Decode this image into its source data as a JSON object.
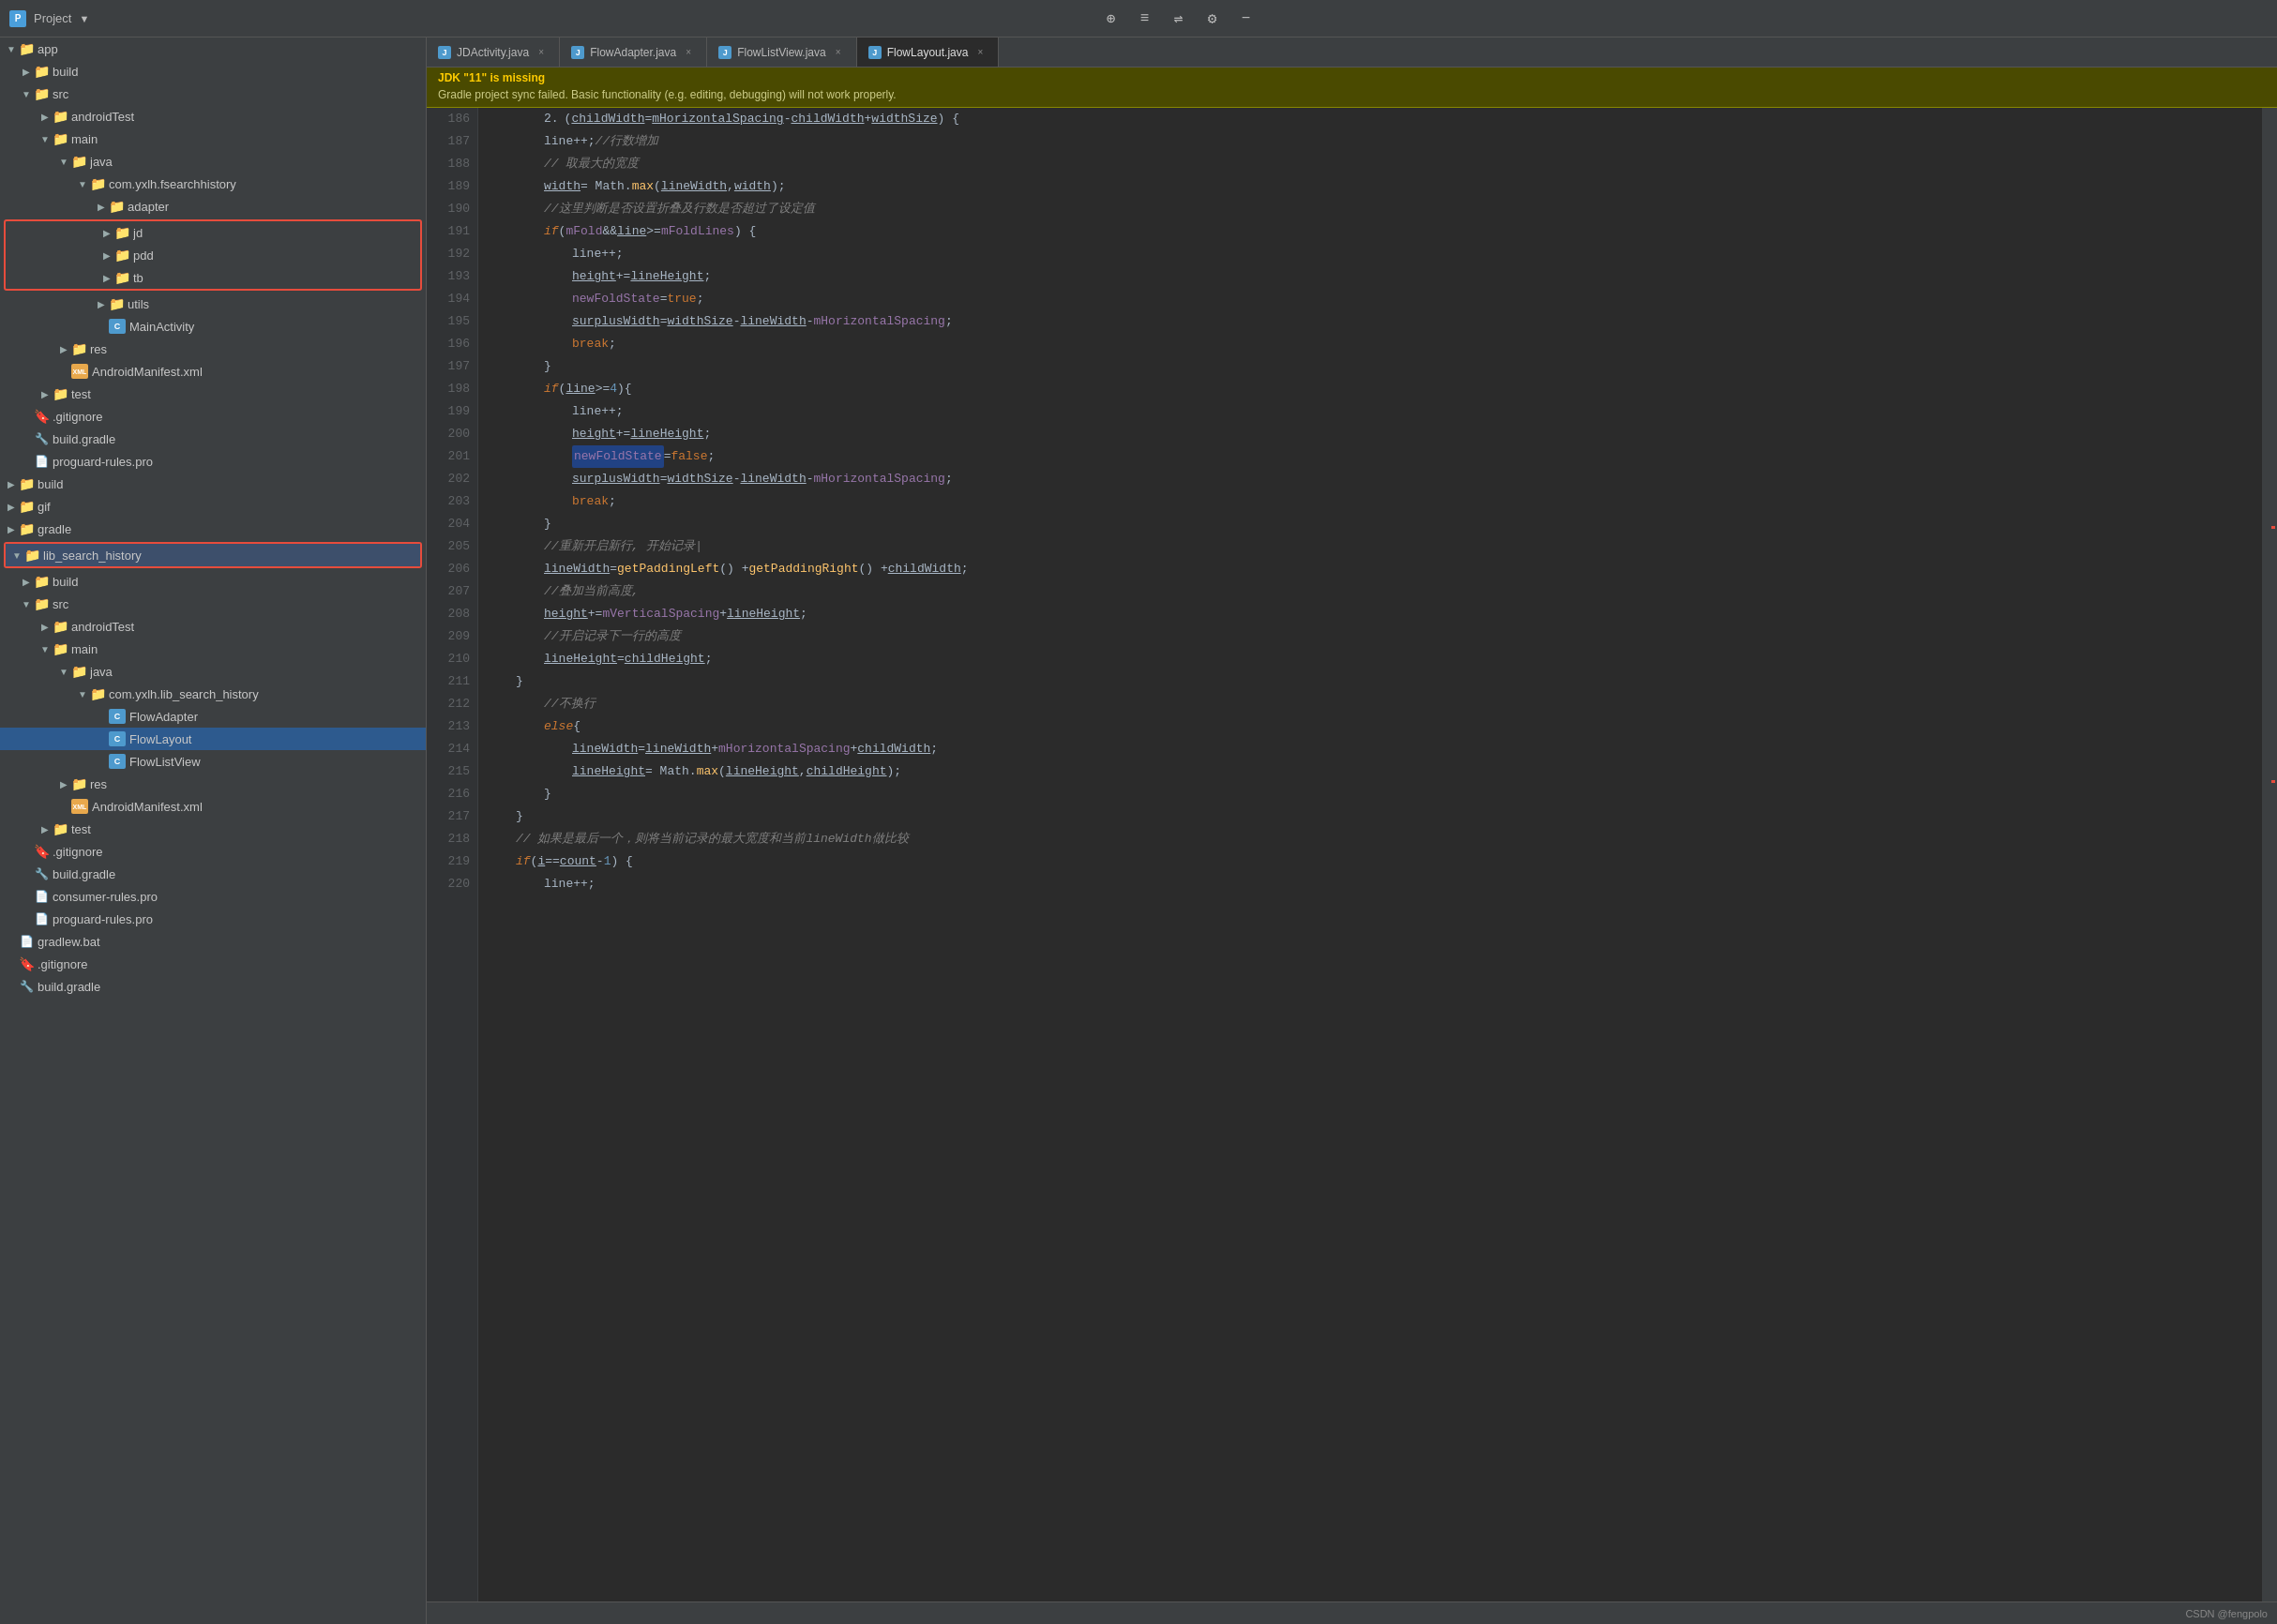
{
  "titlebar": {
    "project_label": "Project",
    "dropdown_arrow": "▼",
    "icons": [
      "⊕",
      "≡",
      "⇌",
      "⚙",
      "−"
    ]
  },
  "tabs": [
    {
      "label": "JDActivity.java",
      "icon_color": "#4e9acd",
      "icon_text": "J",
      "active": false
    },
    {
      "label": "FlowAdapter.java",
      "icon_color": "#4e9acd",
      "icon_text": "J",
      "active": false
    },
    {
      "label": "FlowListView.java",
      "icon_color": "#4e9acd",
      "icon_text": "J",
      "active": false
    },
    {
      "label": "FlowLayout.java",
      "icon_color": "#4e9acd",
      "icon_text": "J",
      "active": true
    }
  ],
  "warning": {
    "title": "JDK \"11\" is missing",
    "description": "Gradle project sync failed. Basic functionality (e.g. editing, debugging) will not work properly."
  },
  "sidebar": {
    "items": [
      {
        "indent": 0,
        "arrow": "▼",
        "icon": "folder",
        "label": "app",
        "type": "folder",
        "selected": false
      },
      {
        "indent": 1,
        "arrow": "▶",
        "icon": "folder",
        "label": "build",
        "type": "folder"
      },
      {
        "indent": 1,
        "arrow": "▼",
        "icon": "folder",
        "label": "src",
        "type": "folder"
      },
      {
        "indent": 2,
        "arrow": "▶",
        "icon": "folder",
        "label": "androidTest",
        "type": "folder"
      },
      {
        "indent": 2,
        "arrow": "▼",
        "icon": "folder",
        "label": "main",
        "type": "folder"
      },
      {
        "indent": 3,
        "arrow": "▼",
        "icon": "folder",
        "label": "java",
        "type": "folder"
      },
      {
        "indent": 4,
        "arrow": "▼",
        "icon": "folder",
        "label": "com.yxlh.fsearchhistory",
        "type": "folder"
      },
      {
        "indent": 5,
        "arrow": "▶",
        "icon": "folder",
        "label": "adapter",
        "type": "folder"
      },
      {
        "indent": 5,
        "arrow": "▶",
        "icon": "folder",
        "label": "jd",
        "type": "folder",
        "red_border": true
      },
      {
        "indent": 5,
        "arrow": "▶",
        "icon": "folder",
        "label": "pdd",
        "type": "folder",
        "red_border": true
      },
      {
        "indent": 5,
        "arrow": "▶",
        "icon": "folder",
        "label": "tb",
        "type": "folder",
        "red_border": true
      },
      {
        "indent": 5,
        "arrow": "▶",
        "icon": "folder",
        "label": "utils",
        "type": "folder"
      },
      {
        "indent": 5,
        "arrow": "",
        "icon": "java",
        "label": "MainActivity",
        "type": "java"
      },
      {
        "indent": 3,
        "arrow": "▶",
        "icon": "folder",
        "label": "res",
        "type": "folder"
      },
      {
        "indent": 3,
        "arrow": "",
        "icon": "xml",
        "label": "AndroidManifest.xml",
        "type": "xml"
      },
      {
        "indent": 2,
        "arrow": "▶",
        "icon": "folder",
        "label": "test",
        "type": "folder"
      },
      {
        "indent": 1,
        "arrow": "",
        "icon": "git",
        "label": ".gitignore",
        "type": "git"
      },
      {
        "indent": 1,
        "arrow": "",
        "icon": "gradle",
        "label": "build.gradle",
        "type": "gradle"
      },
      {
        "indent": 1,
        "arrow": "",
        "icon": "pro",
        "label": "proguard-rules.pro",
        "type": "pro"
      },
      {
        "indent": 0,
        "arrow": "▶",
        "icon": "folder",
        "label": "build",
        "type": "folder"
      },
      {
        "indent": 0,
        "arrow": "▶",
        "icon": "folder",
        "label": "gif",
        "type": "folder"
      },
      {
        "indent": 0,
        "arrow": "▶",
        "icon": "folder",
        "label": "gradle",
        "type": "folder"
      },
      {
        "indent": 0,
        "arrow": "▼",
        "icon": "folder",
        "label": "lib_search_history",
        "type": "folder",
        "red_border_full": true
      },
      {
        "indent": 1,
        "arrow": "▶",
        "icon": "folder",
        "label": "build",
        "type": "folder"
      },
      {
        "indent": 1,
        "arrow": "▼",
        "icon": "folder",
        "label": "src",
        "type": "folder"
      },
      {
        "indent": 2,
        "arrow": "▶",
        "icon": "folder",
        "label": "androidTest",
        "type": "folder"
      },
      {
        "indent": 2,
        "arrow": "▼",
        "icon": "folder",
        "label": "main",
        "type": "folder"
      },
      {
        "indent": 3,
        "arrow": "▼",
        "icon": "folder",
        "label": "java",
        "type": "folder"
      },
      {
        "indent": 4,
        "arrow": "▼",
        "icon": "folder",
        "label": "com.yxlh.lib_search_history",
        "type": "folder"
      },
      {
        "indent": 5,
        "arrow": "",
        "icon": "java",
        "label": "FlowAdapter",
        "type": "java"
      },
      {
        "indent": 5,
        "arrow": "",
        "icon": "java",
        "label": "FlowLayout",
        "type": "java",
        "selected": true
      },
      {
        "indent": 5,
        "arrow": "",
        "icon": "java",
        "label": "FlowListView",
        "type": "java"
      },
      {
        "indent": 3,
        "arrow": "▶",
        "icon": "folder",
        "label": "res",
        "type": "folder"
      },
      {
        "indent": 3,
        "arrow": "",
        "icon": "xml",
        "label": "AndroidManifest.xml",
        "type": "xml"
      },
      {
        "indent": 2,
        "arrow": "▶",
        "icon": "folder",
        "label": "test",
        "type": "folder"
      },
      {
        "indent": 1,
        "arrow": "",
        "icon": "git",
        "label": ".gitignore",
        "type": "git"
      },
      {
        "indent": 1,
        "arrow": "",
        "icon": "gradle",
        "label": "build.gradle",
        "type": "gradle"
      },
      {
        "indent": 1,
        "arrow": "",
        "icon": "pro",
        "label": "consumer-rules.pro",
        "type": "pro"
      },
      {
        "indent": 1,
        "arrow": "",
        "icon": "pro",
        "label": "proguard-rules.pro",
        "type": "pro"
      },
      {
        "indent": 0,
        "arrow": "",
        "icon": "bat",
        "label": "gradlew.bat",
        "type": "bat"
      },
      {
        "indent": 0,
        "arrow": "",
        "icon": "git",
        "label": ".gitignore",
        "type": "git"
      },
      {
        "indent": 0,
        "arrow": "",
        "icon": "gradle",
        "label": "build.gradle",
        "type": "gradle"
      }
    ]
  },
  "code": {
    "lines": [
      {
        "num": 186,
        "content": "line++;<span class='cmt'>// 行数增加</span>",
        "raw": true
      },
      {
        "num": 187,
        "text": "// 取最大的宽度",
        "type": "comment_cn"
      },
      {
        "num": 188,
        "raw_text": "width = Math.max(lineWidth, width);"
      },
      {
        "num": 189,
        "text": "//这里判断是否设置折叠及行数是否超过了设定值",
        "type": "comment_cn"
      },
      {
        "num": 190,
        "raw_text": "if (mFold && line >= mFoldLines) {",
        "fold": true
      },
      {
        "num": 191,
        "raw_text": "    line++;"
      },
      {
        "num": 192,
        "raw_text": "    height += lineHeight;"
      },
      {
        "num": 193,
        "raw_text": "    newFoldState = true;"
      },
      {
        "num": 194,
        "raw_text": "    surplusWidth = widthSize - lineWidth - mHorizontalSpacing;"
      },
      {
        "num": 195,
        "raw_text": "    break;"
      },
      {
        "num": 196,
        "raw_text": "}"
      },
      {
        "num": 197,
        "raw_text": "if(line >= 4){",
        "fold": true
      },
      {
        "num": 198,
        "raw_text": "    line++;"
      },
      {
        "num": 199,
        "raw_text": "    height += lineHeight;",
        "height_underline": true
      },
      {
        "num": 200,
        "raw_text": "    newFoldState = false;",
        "highlight": "newFoldState"
      },
      {
        "num": 201,
        "raw_text": "    surplusWidth = widthSize - lineWidth - mHorizontalSpacing;"
      },
      {
        "num": 202,
        "raw_text": "    break;"
      },
      {
        "num": 203,
        "raw_text": "}"
      },
      {
        "num": 204,
        "text": "//重新开启新行, 开始记录|",
        "type": "comment_cn"
      },
      {
        "num": 205,
        "raw_text": "lineWidth = getPaddingLeft() + getPaddingRight() + childWidth;"
      },
      {
        "num": 206,
        "text": "//叠加当前高度,",
        "type": "comment_cn"
      },
      {
        "num": 207,
        "raw_text": "height += mVerticalSpacing + lineHeight;",
        "height_underline": true
      },
      {
        "num": 208,
        "text": "//开启记录下一行的高度",
        "type": "comment_cn"
      },
      {
        "num": 209,
        "raw_text": "lineHeight = childHeight;"
      },
      {
        "num": 210,
        "raw_text": "}"
      },
      {
        "num": 211,
        "text": "//不换行",
        "type": "comment_cn"
      },
      {
        "num": 212,
        "raw_text": "else {"
      },
      {
        "num": 213,
        "raw_text": "    lineWidth = lineWidth + mHorizontalSpacing + childWidth;"
      },
      {
        "num": 214,
        "raw_text": "    lineHeight = Math.max(lineHeight, childHeight);"
      },
      {
        "num": 215,
        "raw_text": "}"
      },
      {
        "num": 216,
        "raw_text": "}"
      },
      {
        "num": 217,
        "text": "// 如果是最后一个，则将当前记录的最大宽度和当前lineWidth做比较",
        "type": "comment_cn"
      },
      {
        "num": 218,
        "raw_text": "if (i == count - 1) {",
        "fold": true
      },
      {
        "num": 219,
        "raw_text": "    line++;"
      }
    ]
  },
  "status_bar": {
    "watermark": "CSDN @fengpolo"
  }
}
